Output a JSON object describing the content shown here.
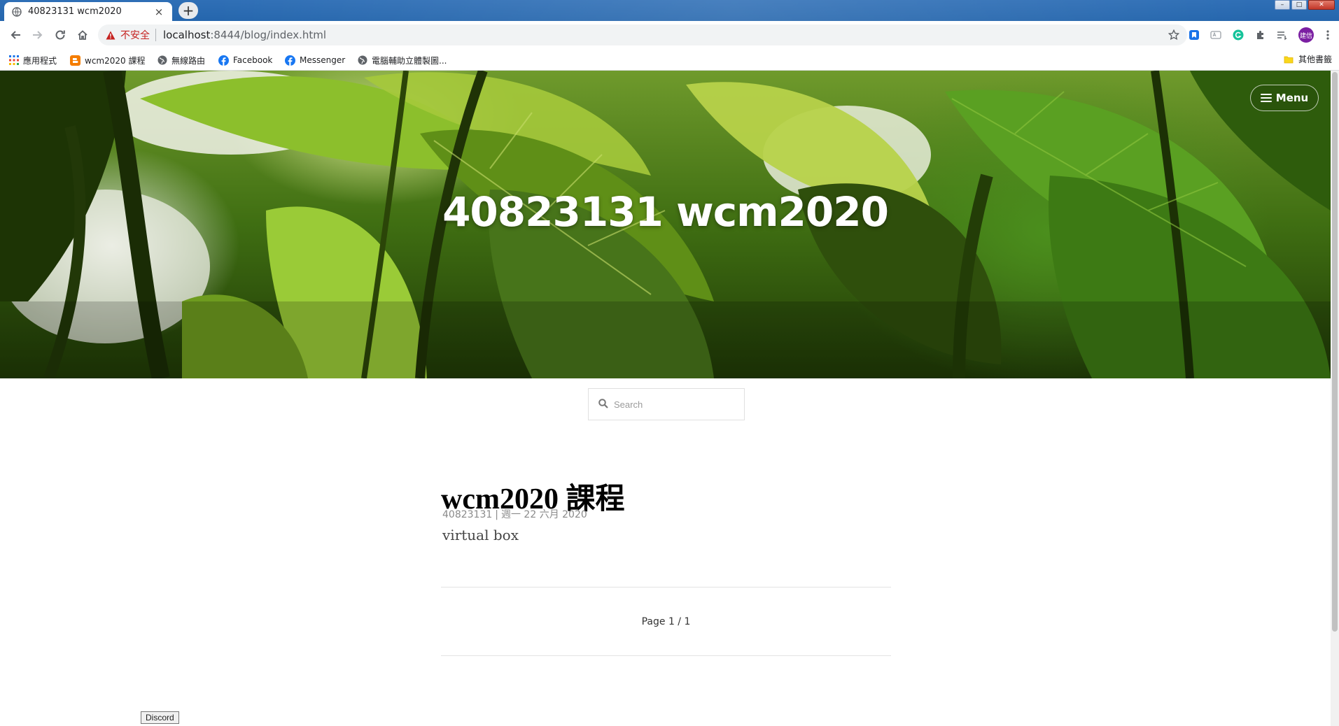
{
  "browser": {
    "tab": {
      "title": "40823131 wcm2020",
      "close_glyph": "×",
      "favicon": "globe-icon"
    },
    "new_tab_glyph": "+",
    "address": {
      "security_label": "不安全",
      "url_host": "localhost",
      "url_path": ":8444/blog/index.html"
    },
    "profile_initials": "建信",
    "bookmarks": [
      {
        "label": "應用程式",
        "icon": "apps-grid-icon"
      },
      {
        "label": "wcm2020 課程",
        "icon": "blogger-icon"
      },
      {
        "label": "無線路由",
        "icon": "globe-icon"
      },
      {
        "label": "Facebook",
        "icon": "facebook-icon"
      },
      {
        "label": "Messenger",
        "icon": "facebook-icon"
      },
      {
        "label": "電腦輔助立體製圖...",
        "icon": "globe-icon"
      }
    ],
    "other_bookmarks": "其他書籤"
  },
  "page": {
    "site_title": "40823131 wcm2020",
    "menu_label": "Menu",
    "search_placeholder": "Search",
    "post": {
      "title": "wcm2020 課程",
      "author": "40823131",
      "meta_separator": "|",
      "date": "週一 22 六月 2020",
      "excerpt": "virtual box"
    },
    "pagination": "Page 1 / 1"
  },
  "taskbar_tooltip": "Discord",
  "colors": {
    "tabstrip": "#2566ad",
    "security_warning": "#c5221f",
    "avatar": "#7b1fa2",
    "hero_green": "#3f6e12"
  }
}
